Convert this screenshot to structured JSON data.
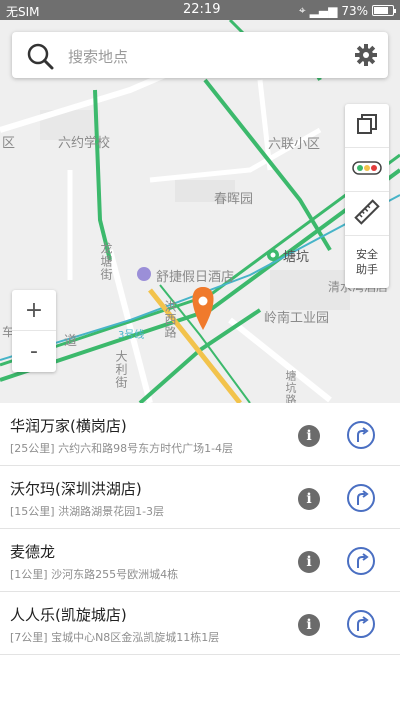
{
  "status_bar": {
    "carrier": "无SIM",
    "time": "22:19",
    "battery": "73%"
  },
  "search": {
    "placeholder": "搜索地点"
  },
  "map": {
    "labels": {
      "liuyue_school": "六约学校",
      "liulian_community": "六联小区",
      "district": "区",
      "chunli_garden": "春晖园",
      "tangkeng": "塘坑",
      "longping_street": "龙塘街",
      "hotel": "舒捷假日酒店",
      "qingshuiwan_hotel": "清水湾酒店",
      "lingnan_industrial": "岭南工业园",
      "hongxi_road": "洪西路",
      "road_dao": "道",
      "dali_road": "大利街",
      "tangkeng_road": "塘坑路",
      "line3": "3号线",
      "left_edge": "车"
    },
    "tools": {
      "safe_label_1": "安全",
      "safe_label_2": "助手"
    },
    "zoom": {
      "in": "+",
      "out": "-"
    },
    "colors": {
      "background": "#efefef",
      "green_road": "#3cb96c",
      "yellow_road": "#f2c34c",
      "teal_line": "#47b4c8",
      "pin": "#f07a2c"
    }
  },
  "results": [
    {
      "name": "华润万家(横岗店)",
      "address": "[25公里] 六约六和路98号东方时代广场1-4层"
    },
    {
      "name": "沃尔玛(深圳洪湖店)",
      "address": "[15公里] 洪湖路湖景花园1-3层"
    },
    {
      "name": "麦德龙",
      "address": "[1公里] 沙河东路255号欧洲城4栋"
    },
    {
      "name": "人人乐(凯旋城店)",
      "address": "[7公里] 宝城中心N8区金泓凯旋城11栋1层"
    }
  ]
}
